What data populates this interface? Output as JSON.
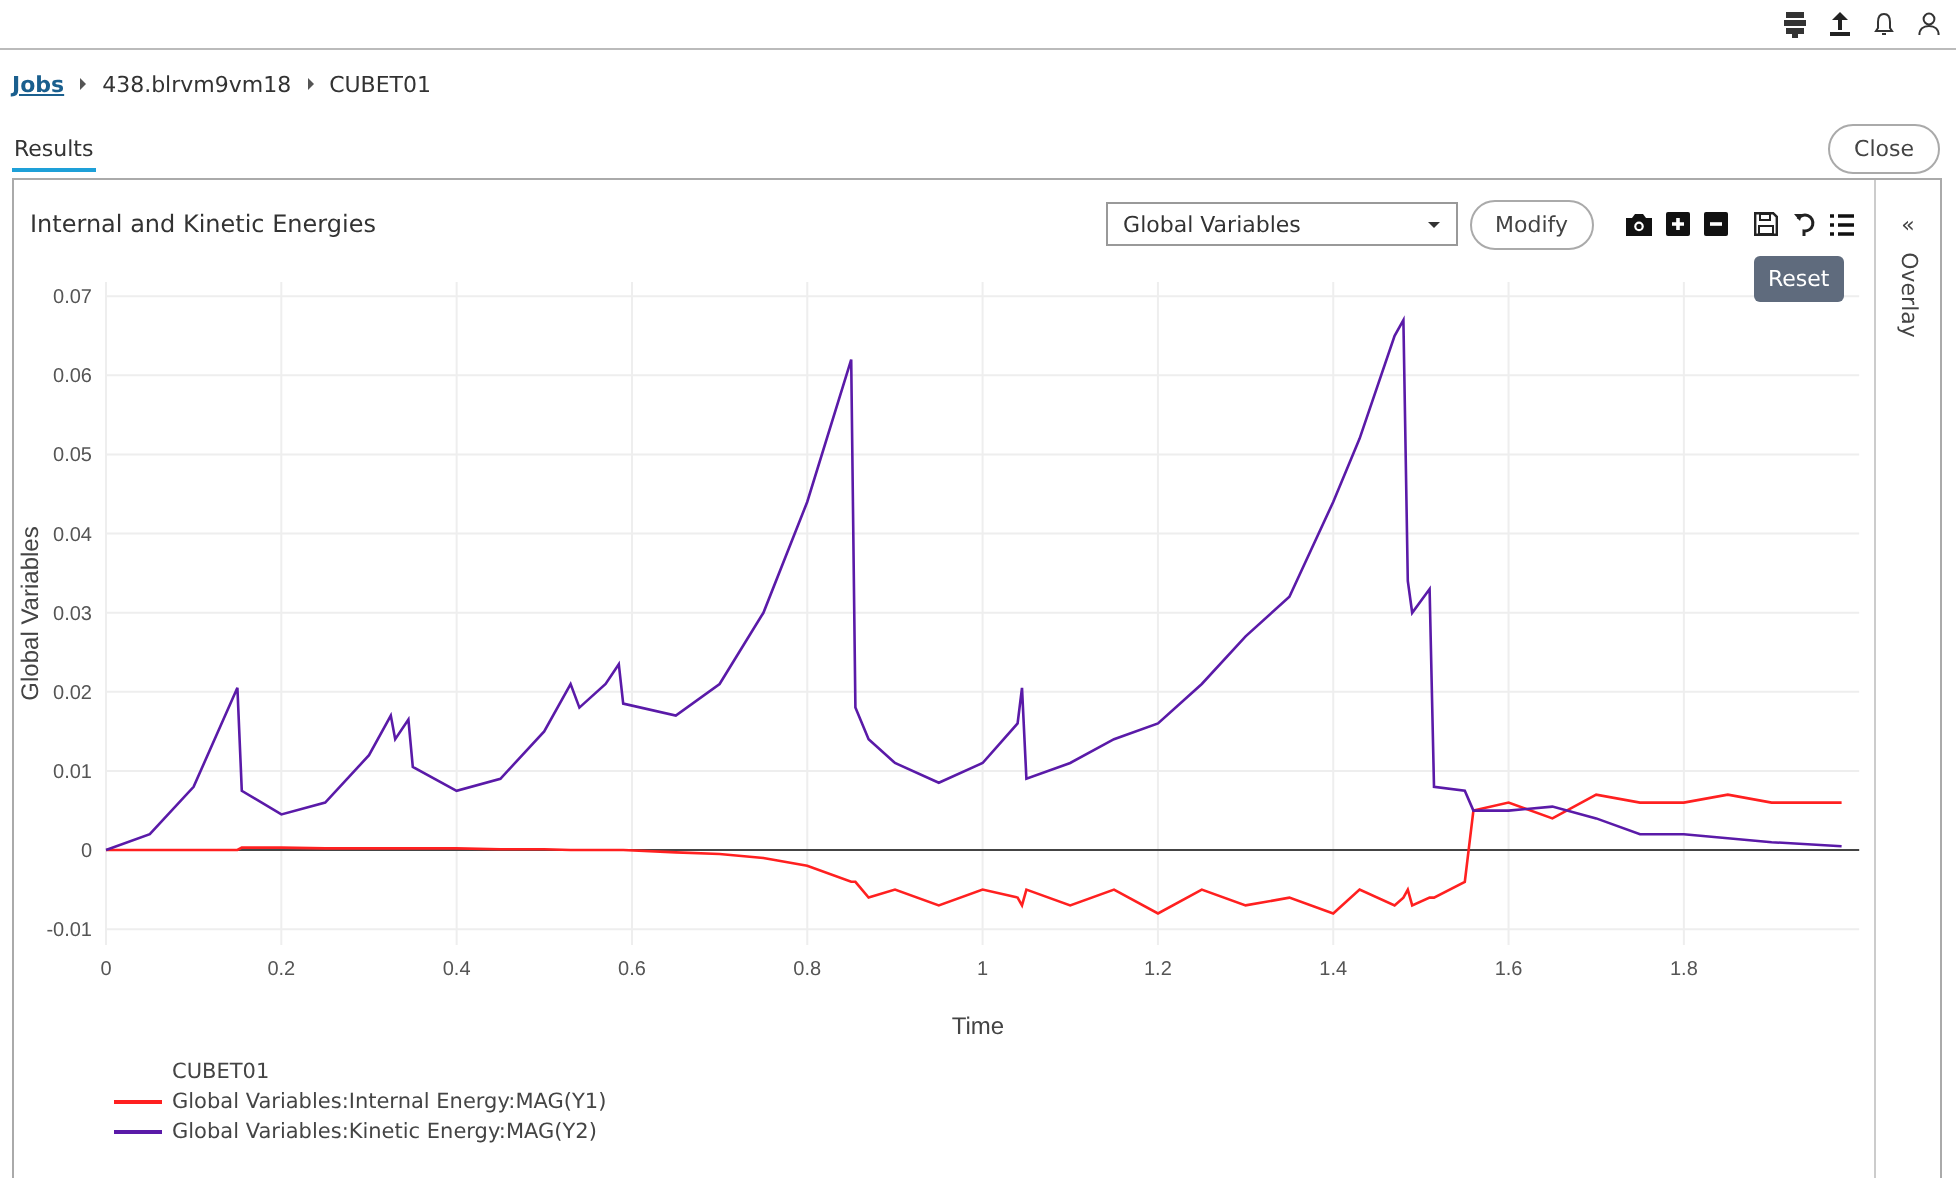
{
  "breadcrumb": [
    {
      "label": "Jobs",
      "kind": "link"
    },
    {
      "label": "438.blrvm9vm18",
      "kind": "text"
    },
    {
      "label": "CUBET01",
      "kind": "text"
    }
  ],
  "tabs": [
    {
      "label": "Results",
      "selected": true
    }
  ],
  "close_button": "Close",
  "panel": {
    "title": "Internal and Kinetic Energies",
    "dropdown": {
      "value": "Global Variables"
    },
    "modify_button": "Modify",
    "tooltip": "Reset",
    "overlay": {
      "glyph": "«",
      "label": "Overlay"
    },
    "chart_data": {
      "type": "line",
      "grid": true,
      "xlabel": "Time",
      "ylabel": "Global Variables",
      "xlim": [
        0,
        2
      ],
      "ylim": [
        -0.012,
        0.0718
      ],
      "xticks": [
        0,
        0.2,
        0.4,
        0.6,
        0.8,
        1,
        1.2,
        1.4,
        1.6,
        1.8
      ],
      "yticks": [
        -0.01,
        0,
        0.01,
        0.02,
        0.03,
        0.04,
        0.05,
        0.06,
        0.07
      ],
      "x": [
        0,
        0.05,
        0.1,
        0.15,
        0.155,
        0.2,
        0.25,
        0.3,
        0.325,
        0.33,
        0.345,
        0.35,
        0.4,
        0.45,
        0.5,
        0.53,
        0.54,
        0.57,
        0.585,
        0.59,
        0.65,
        0.7,
        0.75,
        0.8,
        0.85,
        0.855,
        0.87,
        0.9,
        0.95,
        1.0,
        1.04,
        1.045,
        1.05,
        1.1,
        1.15,
        1.2,
        1.25,
        1.3,
        1.35,
        1.4,
        1.43,
        1.47,
        1.48,
        1.485,
        1.49,
        1.51,
        1.515,
        1.55,
        1.56,
        1.6,
        1.65,
        1.7,
        1.75,
        1.8,
        1.85,
        1.9,
        1.98
      ],
      "series": [
        {
          "name": "Global Variables:Internal Energy:MAG(Y1)",
          "color": "#ff2020",
          "values": [
            0,
            0,
            0,
            0,
            0.0003,
            0.0003,
            0.0002,
            0.0002,
            0.0002,
            0.0002,
            0.0002,
            0.0002,
            0.0002,
            0.0001,
            0.0001,
            0,
            0,
            0,
            0,
            0,
            -0.0003,
            -0.0005,
            -0.001,
            -0.002,
            -0.004,
            -0.004,
            -0.006,
            -0.005,
            -0.007,
            -0.005,
            -0.006,
            -0.007,
            -0.005,
            -0.007,
            -0.005,
            -0.008,
            -0.005,
            -0.007,
            -0.006,
            -0.008,
            -0.005,
            -0.007,
            -0.006,
            -0.005,
            -0.007,
            -0.006,
            -0.006,
            -0.004,
            0.005,
            0.006,
            0.004,
            0.007,
            0.006,
            0.006,
            0.007,
            0.006,
            0.006
          ]
        },
        {
          "name": "Global Variables:Kinetic Energy:MAG(Y2)",
          "color": "#5a1aa8",
          "values": [
            0,
            0.002,
            0.008,
            0.0205,
            0.0075,
            0.0045,
            0.006,
            0.012,
            0.017,
            0.014,
            0.0165,
            0.0105,
            0.0075,
            0.009,
            0.015,
            0.021,
            0.018,
            0.021,
            0.0235,
            0.0185,
            0.017,
            0.021,
            0.03,
            0.044,
            0.062,
            0.018,
            0.014,
            0.011,
            0.0085,
            0.011,
            0.016,
            0.0205,
            0.009,
            0.011,
            0.014,
            0.016,
            0.021,
            0.027,
            0.032,
            0.044,
            0.052,
            0.065,
            0.067,
            0.034,
            0.03,
            0.033,
            0.008,
            0.0075,
            0.005,
            0.005,
            0.0055,
            0.004,
            0.002,
            0.002,
            0.0015,
            0.001,
            0.0005
          ]
        }
      ]
    },
    "legend": {
      "title": "CUBET01"
    }
  }
}
